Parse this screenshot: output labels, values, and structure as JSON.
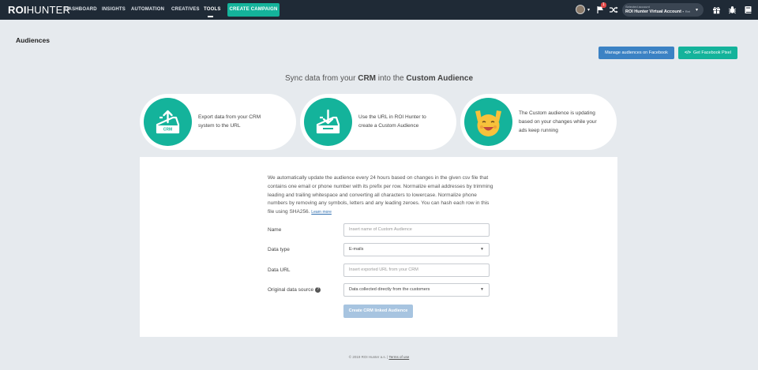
{
  "nav": {
    "logo_bold": "ROI",
    "logo_rest": "HUNTER",
    "items": [
      {
        "label": "DASHBOARD"
      },
      {
        "label": "INSIGHTS"
      },
      {
        "label": "AUTOMATION"
      },
      {
        "label": "CREATIVES"
      },
      {
        "label": "TOOLS"
      }
    ],
    "create_campaign": "CREATE CAMPAIGN",
    "notification_count": "1",
    "account_caption": "Selected account",
    "account_name": "ROI Hunter Virtual Account -",
    "account_suffix": "Ret"
  },
  "page": {
    "title": "Audiences",
    "manage_button": "Manage audiences on Facebook",
    "pixel_button": "Get Facebook Pixel",
    "pixel_code_glyph": "</>"
  },
  "sync": {
    "prefix": "Sync data from your ",
    "crm": "CRM",
    "middle": " into the ",
    "audience": "Custom Audience"
  },
  "steps": [
    {
      "line1": "Export data from your CRM",
      "line2": "system to the URL",
      "icon": "crm-export-icon",
      "badge": "CRM"
    },
    {
      "line1": "Use the URL in ROI Hunter to",
      "line2": "create a Custom Audience",
      "icon": "download-tray-icon"
    },
    {
      "line1": "The Custom audience is updating",
      "line2": "based on your changes while your",
      "line3": "ads keep running",
      "icon": "cheering-face-icon"
    }
  ],
  "form": {
    "description": "We automatically update the audience every 24 hours based on changes in the given csv file that contains one email or phone number with its prefix per row. Normalize email addresses by trimming leading and trailing whitespace and converting all characters to lowercase. Normalize phone numbers by removing any symbols, letters and any leading zeroes. You can hash each row in this file using SHA256.",
    "learn_more": "Learn more",
    "name_label": "Name",
    "name_placeholder": "Insert name of Custom Audience",
    "type_label": "Data type",
    "type_value": "E-mails",
    "url_label": "Data URL",
    "url_placeholder": "Insert exported URL from your CRM",
    "source_label": "Original data source",
    "source_value": "Data collected directly from the customers",
    "submit": "Create CRM linked Audience"
  },
  "footer": {
    "copyright": "© 2019 ROI Hunter a.s. | ",
    "terms": "Terms of use"
  },
  "colors": {
    "nav_bg": "#1f2a36",
    "accent": "#14b39b",
    "primary": "#3b82c4",
    "page_bg": "#e6eaee"
  }
}
